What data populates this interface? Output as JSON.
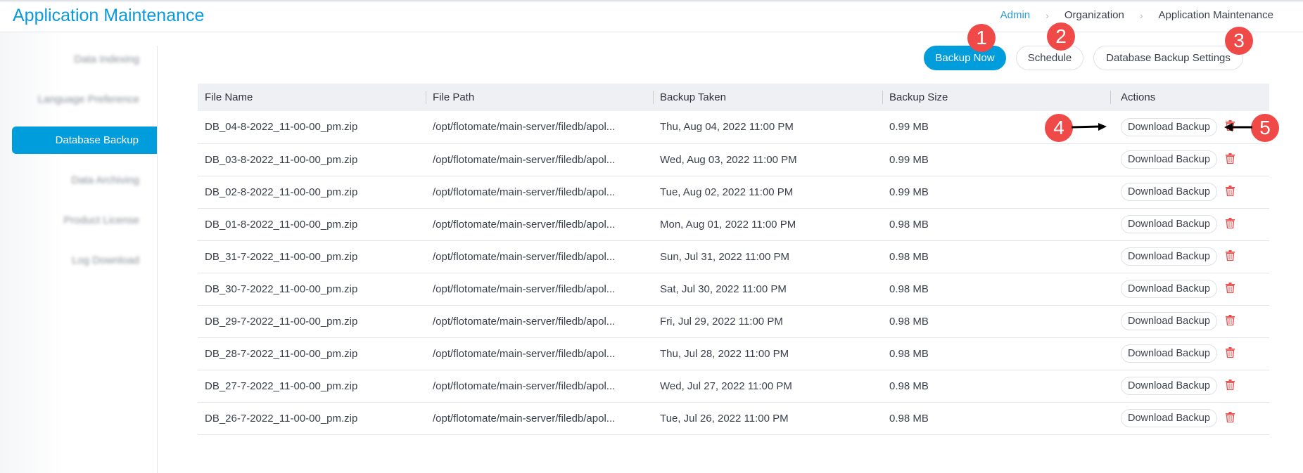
{
  "header": {
    "title": "Application Maintenance",
    "breadcrumb": [
      "Admin",
      "Organization",
      "Application Maintenance"
    ]
  },
  "sidebar": {
    "items": [
      {
        "label": "Data Indexing",
        "active": false
      },
      {
        "label": "Language Preference",
        "active": false
      },
      {
        "label": "Database Backup",
        "active": true
      },
      {
        "label": "Data Archiving",
        "active": false
      },
      {
        "label": "Product License",
        "active": false
      },
      {
        "label": "Log Download",
        "active": false
      }
    ]
  },
  "toolbar": {
    "backup_now": "Backup Now",
    "schedule": "Schedule",
    "settings": "Database Backup Settings"
  },
  "table": {
    "columns": [
      "File Name",
      "File Path",
      "Backup Taken",
      "Backup Size",
      "Actions"
    ],
    "download_label": "Download Backup",
    "rows": [
      [
        "DB_04-8-2022_11-00-00_pm.zip",
        "/opt/flotomate/main-server/filedb/apol...",
        "Thu, Aug 04, 2022 11:00 PM",
        "0.99 MB"
      ],
      [
        "DB_03-8-2022_11-00-00_pm.zip",
        "/opt/flotomate/main-server/filedb/apol...",
        "Wed, Aug 03, 2022 11:00 PM",
        "0.99 MB"
      ],
      [
        "DB_02-8-2022_11-00-00_pm.zip",
        "/opt/flotomate/main-server/filedb/apol...",
        "Tue, Aug 02, 2022 11:00 PM",
        "0.99 MB"
      ],
      [
        "DB_01-8-2022_11-00-00_pm.zip",
        "/opt/flotomate/main-server/filedb/apol...",
        "Mon, Aug 01, 2022 11:00 PM",
        "0.98 MB"
      ],
      [
        "DB_31-7-2022_11-00-00_pm.zip",
        "/opt/flotomate/main-server/filedb/apol...",
        "Sun, Jul 31, 2022 11:00 PM",
        "0.98 MB"
      ],
      [
        "DB_30-7-2022_11-00-00_pm.zip",
        "/opt/flotomate/main-server/filedb/apol...",
        "Sat, Jul 30, 2022 11:00 PM",
        "0.98 MB"
      ],
      [
        "DB_29-7-2022_11-00-00_pm.zip",
        "/opt/flotomate/main-server/filedb/apol...",
        "Fri, Jul 29, 2022 11:00 PM",
        "0.98 MB"
      ],
      [
        "DB_28-7-2022_11-00-00_pm.zip",
        "/opt/flotomate/main-server/filedb/apol...",
        "Thu, Jul 28, 2022 11:00 PM",
        "0.98 MB"
      ],
      [
        "DB_27-7-2022_11-00-00_pm.zip",
        "/opt/flotomate/main-server/filedb/apol...",
        "Wed, Jul 27, 2022 11:00 PM",
        "0.98 MB"
      ],
      [
        "DB_26-7-2022_11-00-00_pm.zip",
        "/opt/flotomate/main-server/filedb/apol...",
        "Tue, Jul 26, 2022 11:00 PM",
        "0.98 MB"
      ]
    ]
  },
  "callouts": [
    "1",
    "2",
    "3",
    "4",
    "5"
  ],
  "colors": {
    "accent": "#009ddc",
    "delete": "#f04a48",
    "callout": "#f04a48"
  }
}
